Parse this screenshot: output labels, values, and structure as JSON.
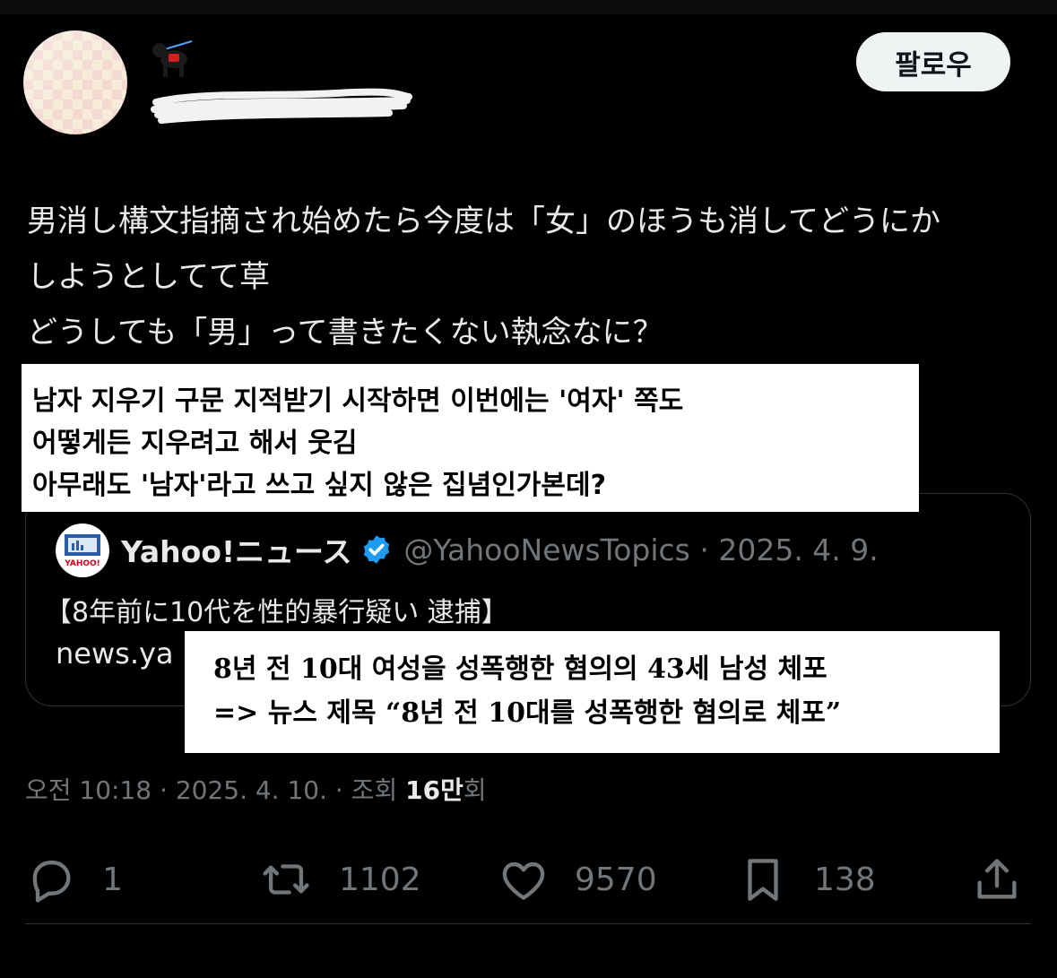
{
  "tweet": {
    "author_emoji_icon": "dog-with-red-bag-icon",
    "follow_label": "팔로우",
    "text_lines": [
      "男消し構文指摘され始めたら今度は「女」のほうも消してどうにか",
      "しようとしてて草",
      "どうしても「男」って書きたくない執念なに？"
    ],
    "meta": {
      "time_date": "오전 10:18 · 2025. 4. 10. · 조회 ",
      "views_number": "16만",
      "views_suffix": "회"
    },
    "actions": {
      "reply_count": "1",
      "retweet_count": "1102",
      "like_count": "9570",
      "bookmark_count": "138"
    }
  },
  "quote": {
    "name": "Yahoo!ニュース",
    "handle_date": "@YahooNewsTopics · 2025. 4. 9.",
    "headline": "【8年前に10代を性的暴行疑い 逮捕】",
    "link": "news.ya",
    "logo_text": "YAHOO!"
  },
  "overlays": {
    "top_lines": [
      "남자 지우기 구문 지적받기 시작하면 이번에는 '여자' 쪽도",
      "어떻게든 지우려고 해서 웃김",
      "아무래도 '남자'라고 쓰고 싶지 않은 집념인가본데?"
    ],
    "bottom_lines": [
      "8년 전 10대 여성을 성폭행한 혐의의 43세 남성 체포",
      "=> 뉴스 제목 “8년 전 10대를 성폭행한 혐의로 체포”"
    ]
  },
  "colors": {
    "background": "#000000",
    "text": "#e7e9ea",
    "muted": "#71767b",
    "verified_blue": "#1d9bf0",
    "follow_bg": "#eff3f4"
  }
}
